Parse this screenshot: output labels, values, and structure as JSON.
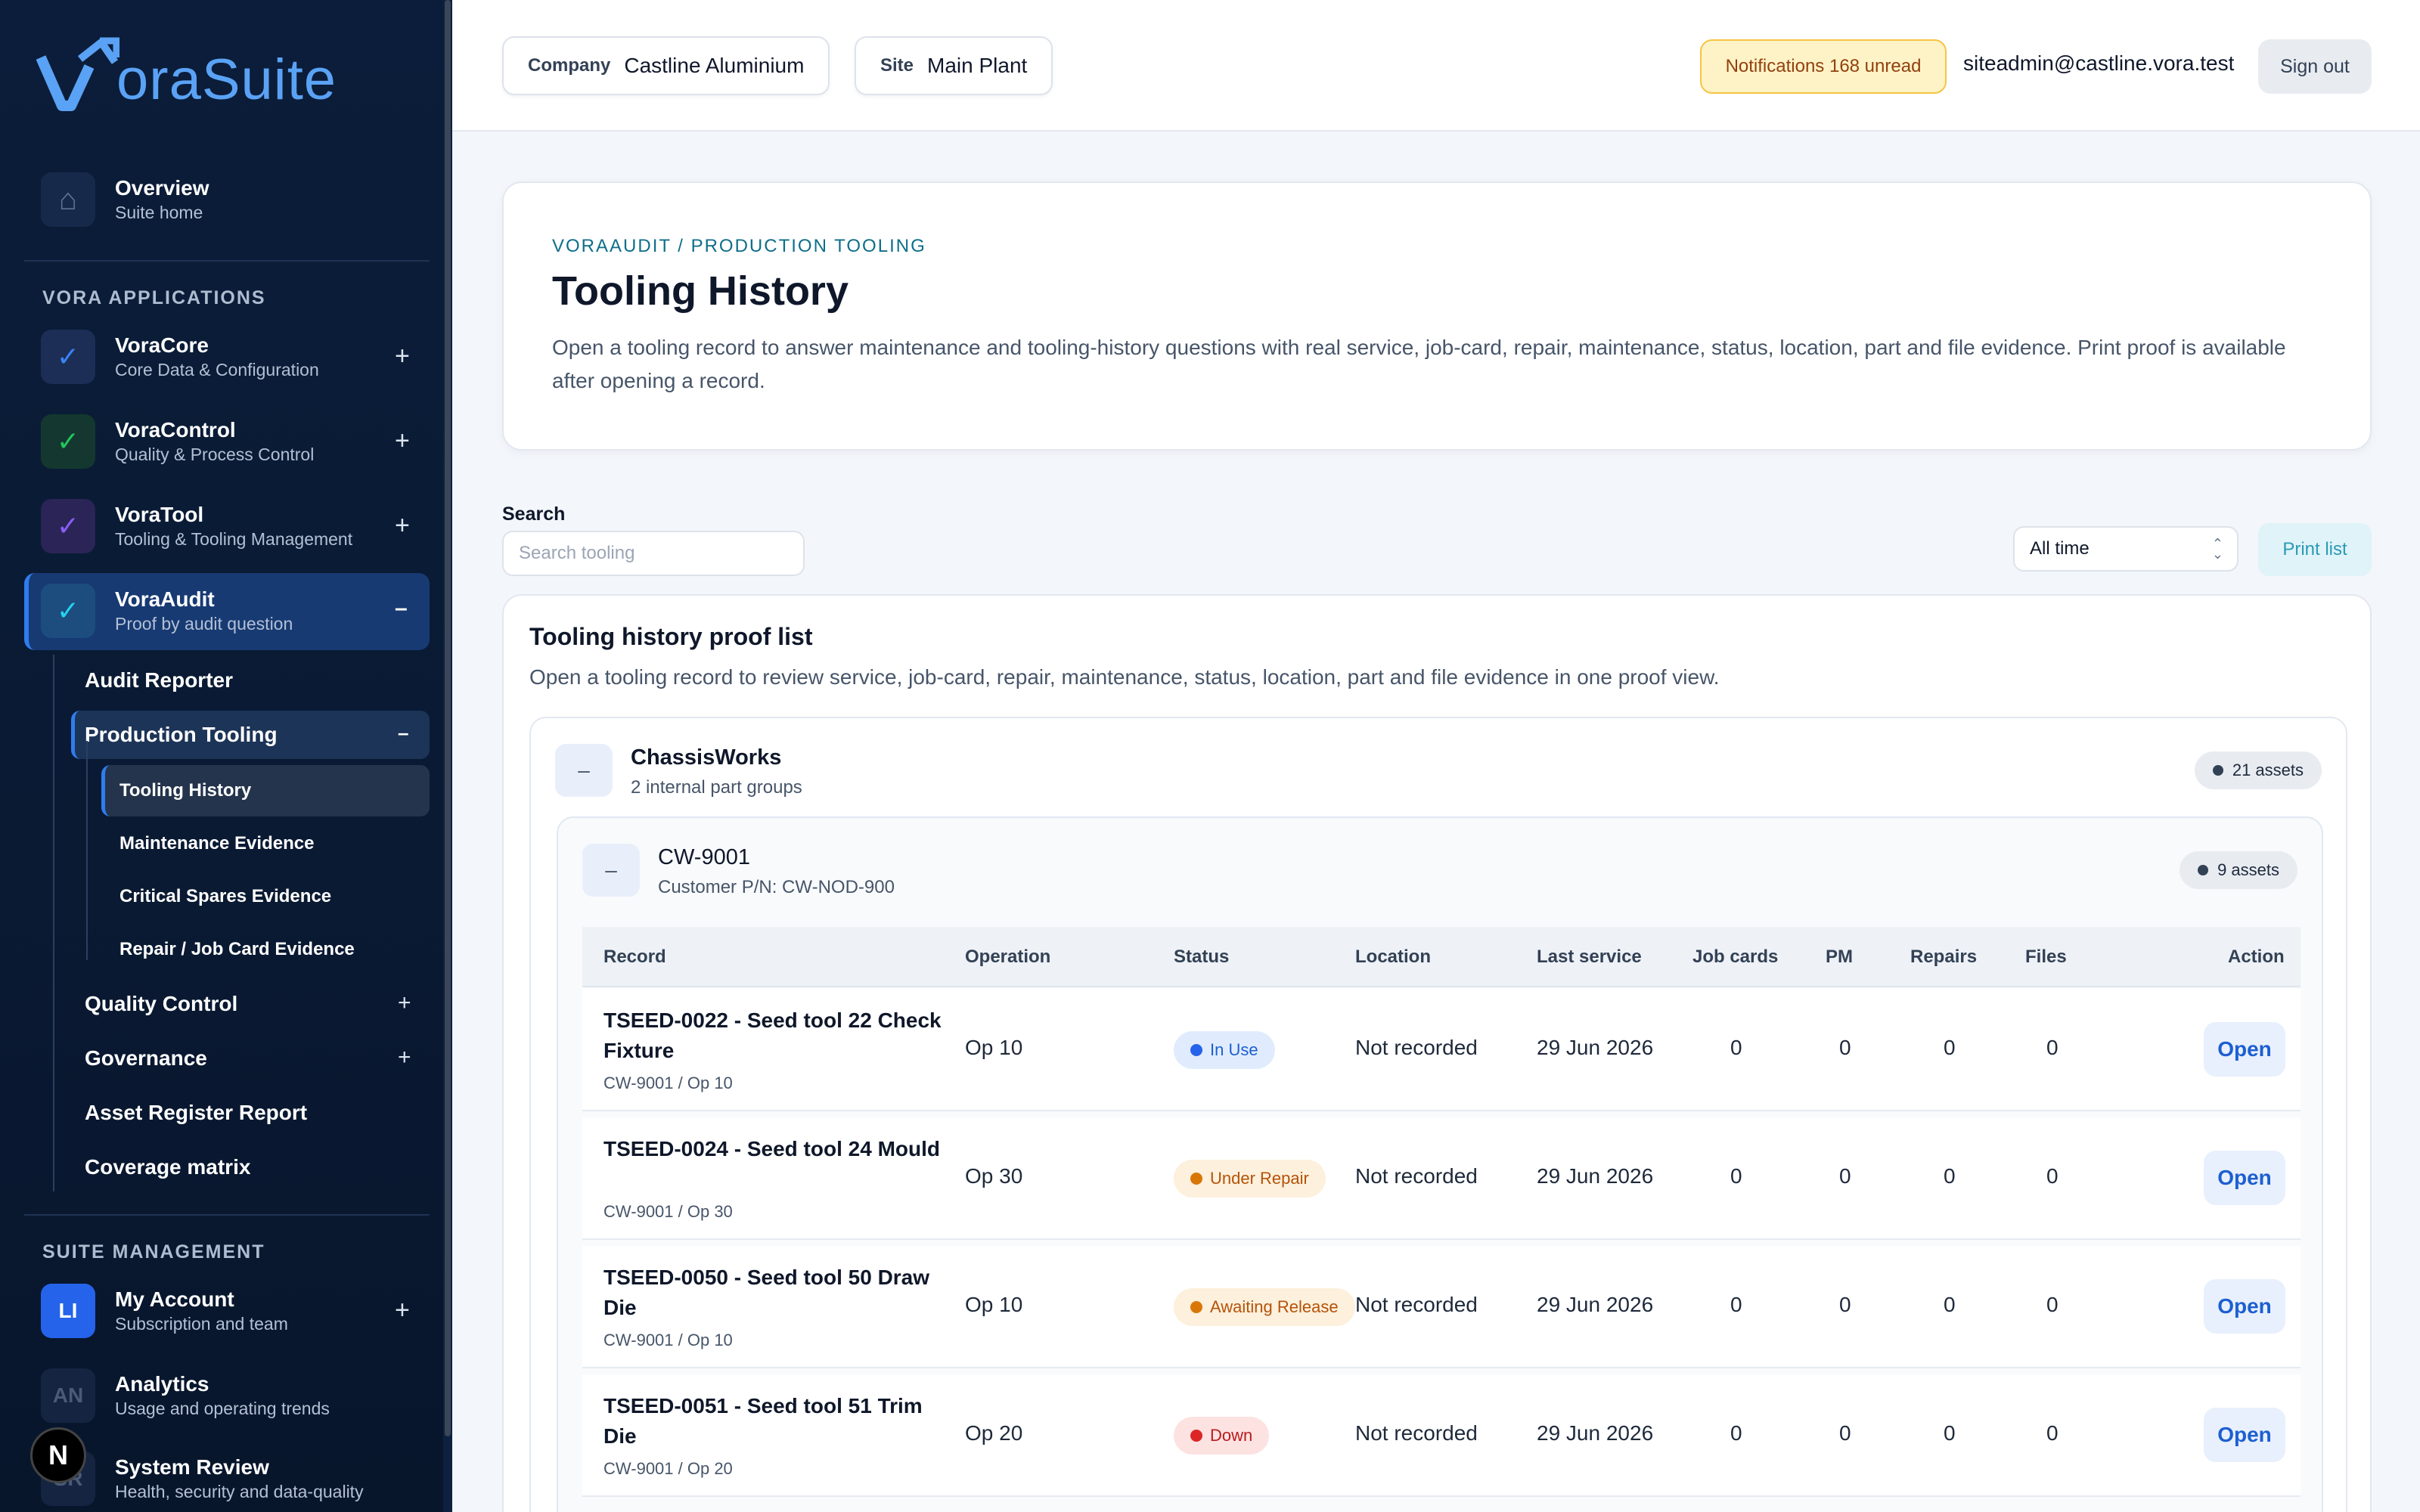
{
  "brand": {
    "logo_text": "oraSuite",
    "accent": "#5aa2f5"
  },
  "sidebar": {
    "overview": {
      "title": "Overview",
      "subtitle": "Suite home"
    },
    "apps_label": "VORA APPLICATIONS",
    "apps": [
      {
        "title": "VoraCore",
        "subtitle": "Core Data & Configuration",
        "icon": "check-icon",
        "color": "#3b82f6"
      },
      {
        "title": "VoraControl",
        "subtitle": "Quality & Process Control",
        "icon": "check-icon",
        "color": "#22c55e"
      },
      {
        "title": "VoraTool",
        "subtitle": "Tooling & Tooling Management",
        "icon": "check-icon",
        "color": "#8b5cf6"
      },
      {
        "title": "VoraAudit",
        "subtitle": "Proof by audit question",
        "icon": "check-icon",
        "color": "#06b6d4"
      }
    ],
    "audit_menu": {
      "audit_reporter": "Audit Reporter",
      "production_tooling": "Production Tooling",
      "production_children": [
        "Tooling History",
        "Maintenance Evidence",
        "Critical Spares Evidence",
        "Repair / Job Card Evidence"
      ],
      "quality_control": "Quality Control",
      "governance": "Governance",
      "asset_register": "Asset Register Report",
      "coverage_matrix": "Coverage matrix"
    },
    "management_label": "SUITE MANAGEMENT",
    "management": [
      {
        "title": "My Account",
        "subtitle": "Subscription and team",
        "initials": "LI"
      },
      {
        "title": "Analytics",
        "subtitle": "Usage and operating trends",
        "initials": "AN"
      },
      {
        "title": "System Review",
        "subtitle": "Health, security and data-quality",
        "initials": "SR"
      }
    ],
    "n_badge": "N"
  },
  "topbar": {
    "company_label": "Company",
    "company_value": "Castline Aluminium",
    "site_label": "Site",
    "site_value": "Main Plant",
    "notifications": "Notifications 168 unread",
    "user_email": "siteadmin@castline.vora.test",
    "sign_out": "Sign out"
  },
  "header": {
    "breadcrumb": "VORAAUDIT / PRODUCTION TOOLING",
    "title": "Tooling History",
    "description": "Open a tooling record to answer maintenance and tooling-history questions with real service, job-card, repair, maintenance, status, location, part and file evidence. Print proof is available after opening a record."
  },
  "filters": {
    "search_label": "Search",
    "search_placeholder": "Search tooling",
    "range_value": "All time",
    "print_label": "Print list"
  },
  "proof_list": {
    "title": "Tooling history proof list",
    "description": "Open a tooling record to review service, job-card, repair, maintenance, status, location, part and file evidence in one proof view.",
    "toggle_symbol": "–",
    "group": {
      "name": "ChassisWorks",
      "subtitle": "2 internal part groups",
      "count": "21 assets"
    },
    "part": {
      "name": "CW-9001",
      "subtitle": "Customer P/N: CW-NOD-900",
      "count": "9 assets"
    },
    "columns": [
      "Record",
      "Operation",
      "Status",
      "Location",
      "Last service",
      "Job cards",
      "PM",
      "Repairs",
      "Files",
      "Action"
    ],
    "rows": [
      {
        "title": "TSEED-0022 - Seed tool 22 Check Fixture",
        "sub": "CW-9001 / Op 10",
        "operation": "Op 10",
        "status": "In Use",
        "status_bg": "#e0ecfd",
        "status_fg": "#1d5fd0",
        "status_dot": "#2563eb",
        "location": "Not recorded",
        "last_service": "29 Jun 2026",
        "job_cards": "0",
        "pm": "0",
        "repairs": "0",
        "files": "0",
        "action": "Open"
      },
      {
        "title": "TSEED-0024 - Seed tool 24 Mould",
        "sub": "CW-9001 / Op 30",
        "operation": "Op 30",
        "status": "Under Repair",
        "status_bg": "#fdf0dc",
        "status_fg": "#b45309",
        "status_dot": "#d97706",
        "location": "Not recorded",
        "last_service": "29 Jun 2026",
        "job_cards": "0",
        "pm": "0",
        "repairs": "0",
        "files": "0",
        "action": "Open"
      },
      {
        "title": "TSEED-0050 - Seed tool 50 Draw Die",
        "sub": "CW-9001 / Op 10",
        "operation": "Op 10",
        "status": "Awaiting Release",
        "status_bg": "#fdf0dc",
        "status_fg": "#b45309",
        "status_dot": "#d97706",
        "location": "Not recorded",
        "last_service": "29 Jun 2026",
        "job_cards": "0",
        "pm": "0",
        "repairs": "0",
        "files": "0",
        "action": "Open"
      },
      {
        "title": "TSEED-0051 - Seed tool 51 Trim Die",
        "sub": "CW-9001 / Op 20",
        "operation": "Op 20",
        "status": "Down",
        "status_bg": "#fde2e2",
        "status_fg": "#b91c1c",
        "status_dot": "#dc2626",
        "location": "Not recorded",
        "last_service": "29 Jun 2026",
        "job_cards": "0",
        "pm": "0",
        "repairs": "0",
        "files": "0",
        "action": "Open"
      }
    ]
  }
}
